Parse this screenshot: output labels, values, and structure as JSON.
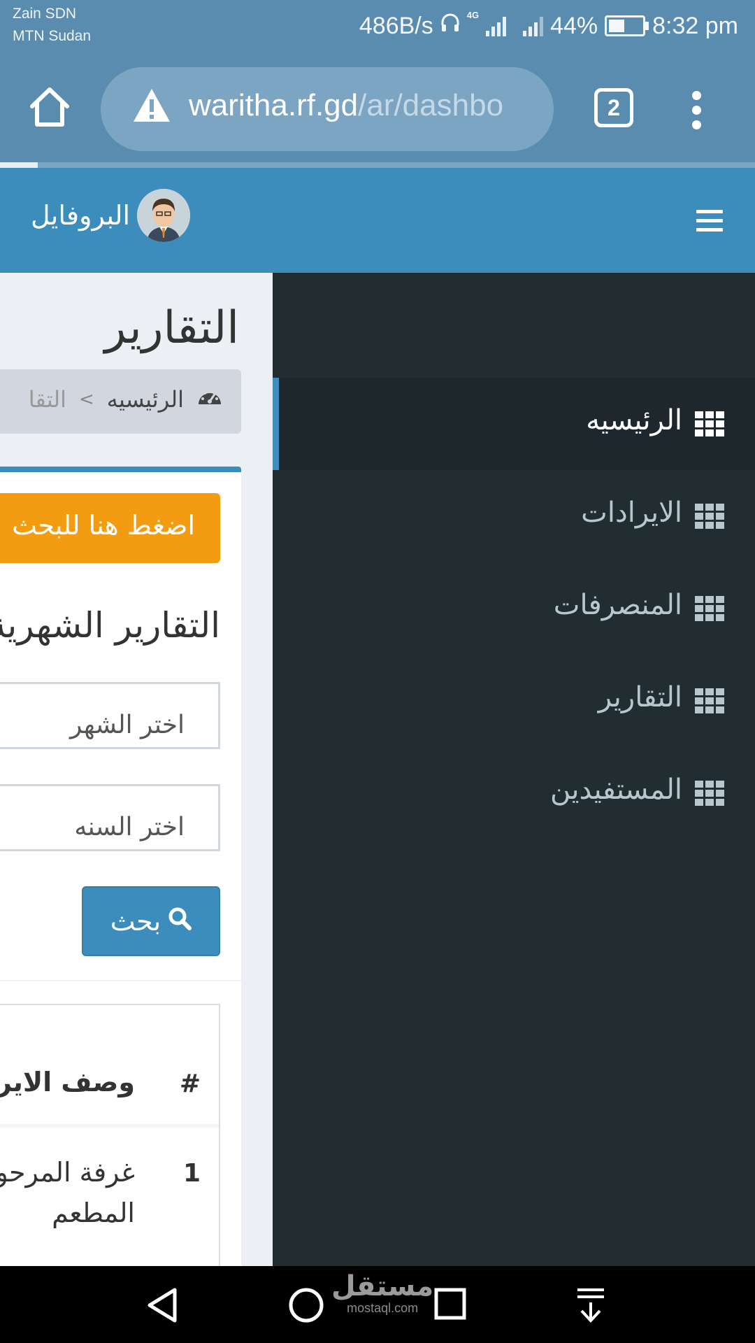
{
  "status_bar": {
    "carrier_1": "Zain SDN",
    "carrier_2": "MTN Sudan",
    "net_speed": "486B/s",
    "network_type": "4G",
    "battery": "44%",
    "time": "8:32 pm"
  },
  "browser": {
    "url_host": "waritha.rf.gd",
    "url_path": "/ar/dashbo",
    "tab_count": "2",
    "load_progress": 0.05
  },
  "header": {
    "profile_label": "البروفايل"
  },
  "sidebar": {
    "items": [
      {
        "label": "الرئيسيه",
        "active": true
      },
      {
        "label": "الايرادات",
        "active": false
      },
      {
        "label": "المنصرفات",
        "active": false
      },
      {
        "label": "التقارير",
        "active": false
      },
      {
        "label": "المستفيدين",
        "active": false
      }
    ]
  },
  "main": {
    "page_title": "التقارير",
    "breadcrumb": {
      "home": "الرئيسيه",
      "separator": ">",
      "current": "التقا"
    },
    "search_toggle_label": "اضغط هنا للبحث",
    "monthly_title": "التقارير الشهرية",
    "month_select_value": "اختر الشهر",
    "year_select_value": "اختر السنه",
    "search_button_label": "بحث",
    "table": {
      "headers": [
        "#",
        "وصف الايرادات"
      ],
      "rows": [
        {
          "num": "1",
          "description": "غرفة المرحوم المطعم"
        }
      ]
    }
  },
  "nav_bar": {
    "watermark_ar": "مستقل",
    "watermark_en": "mostaql.com"
  },
  "colors": {
    "header_blue": "#3c8dbc",
    "sidebar_dark": "#222d32",
    "warning_orange": "#f39c12",
    "browser_bar": "#5a8cb0"
  }
}
